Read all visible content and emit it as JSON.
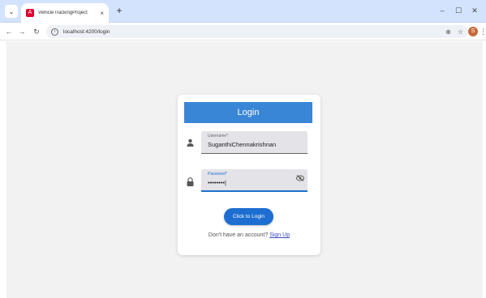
{
  "browser": {
    "tab_menu_glyph": "⌄",
    "tab_title": "VehicleTrackingProject",
    "tab_close": "×",
    "new_tab": "+",
    "window_controls": {
      "minimize": "–",
      "maximize": "☐",
      "close": "✕"
    },
    "url": "localhost:4200/login",
    "profile_initial": "S"
  },
  "login": {
    "title": "Login",
    "username_label": "Username*",
    "username_value": "SuganthiChennakrishnan",
    "password_label": "Password*",
    "password_value": "••••••••|",
    "submit_label": "Click to Login",
    "signup_prompt": "Don't have an account?",
    "signup_link": "Sign Up"
  },
  "colors": {
    "header": "#3a86d6",
    "button": "#1e6ed1",
    "link": "#3b4cc6",
    "page_bg": "#f2f2f2"
  }
}
